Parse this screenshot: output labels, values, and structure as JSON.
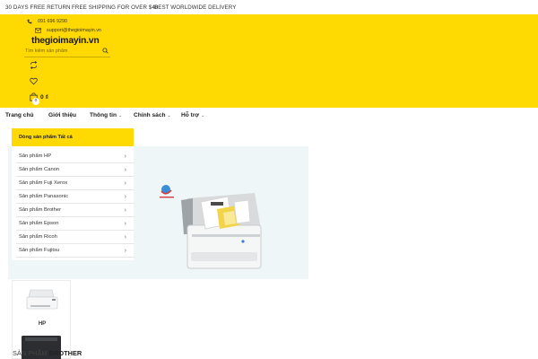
{
  "topbar": {
    "items": [
      "30 DAYS FREE RETURN",
      "FREE SHIPPING FOR OVER $40",
      "BEST WORLDWIDE DELIVERY"
    ]
  },
  "header": {
    "phone": "091 696 9290",
    "email": "support@thegioimayin.vn",
    "logo": "thegioimayin.vn",
    "search_placeholder": "Tìm kiếm sản phẩm",
    "compare_count": "0",
    "cart_total": "0 ₫",
    "cart_icon": "bag-icon",
    "accent_color": "#ffd901"
  },
  "nav": {
    "items": [
      {
        "label": "Trang chủ",
        "dropdown": false
      },
      {
        "label": "Giới thiệu",
        "dropdown": false
      },
      {
        "label": "Thông tin",
        "dropdown": true
      },
      {
        "label": "Chính sách",
        "dropdown": true
      },
      {
        "label": "Hỗ trợ",
        "dropdown": true
      }
    ]
  },
  "categories": {
    "heading": "Dòng sản phẩm Tất cả",
    "items": [
      "Sản phẩm HP",
      "Sản phẩm Canon",
      "Sản phẩm Fuji Xerox",
      "Sản phẩm Panasonic",
      "Sản phẩm Brother",
      "Sản phẩm Epson",
      "Sản phẩm Ricoh",
      "Sản phẩm Fujitsu"
    ]
  },
  "products": [
    {
      "name": "HP"
    }
  ],
  "section": {
    "prefix": "SẢN PHẨM",
    "brand": "BROTHER"
  }
}
